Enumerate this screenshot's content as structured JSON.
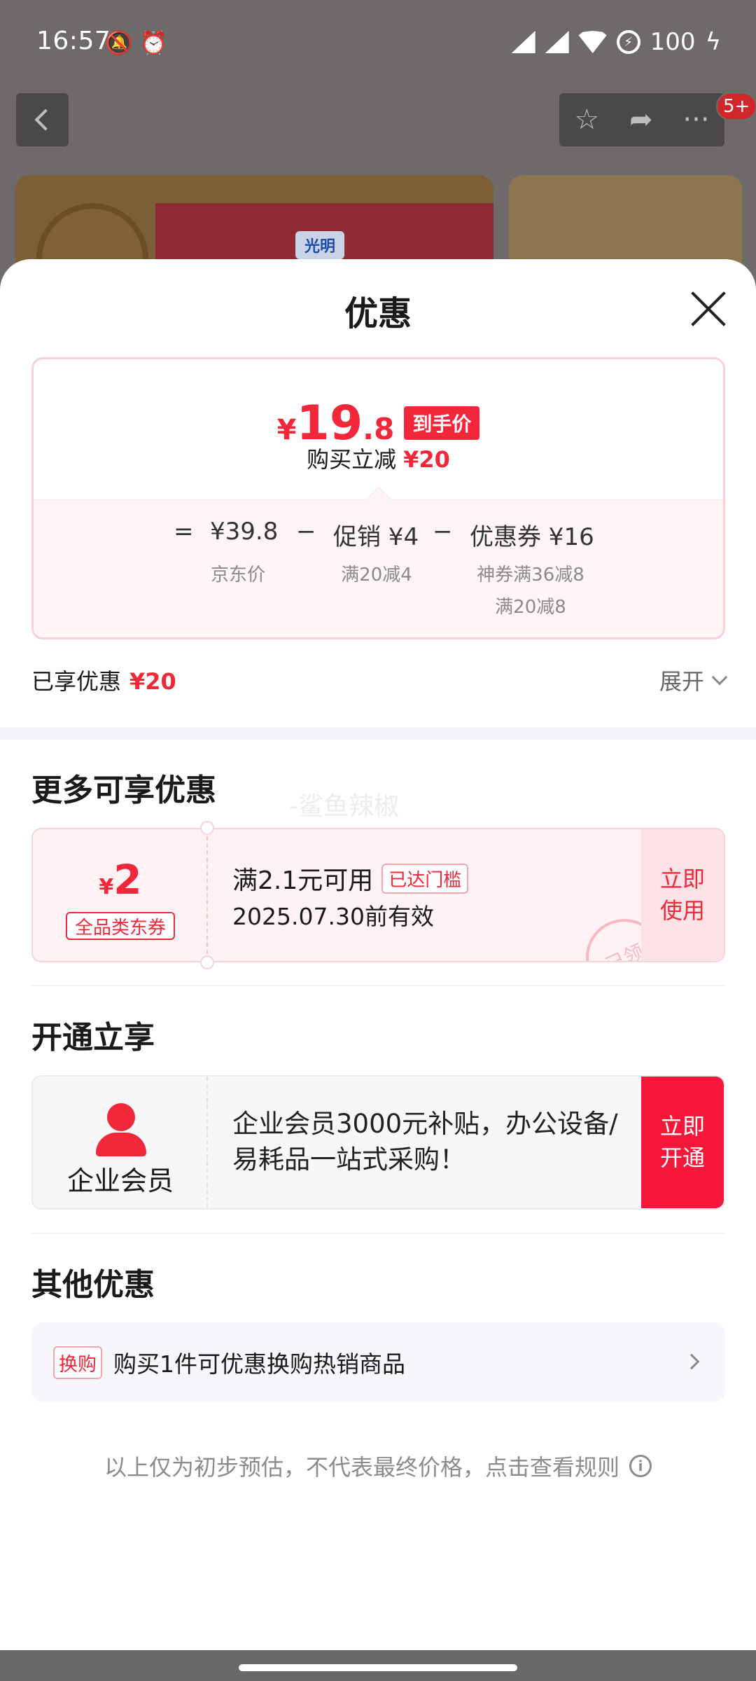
{
  "status_bar": {
    "time": "16:57",
    "battery": "100",
    "left_icons": [
      "mute-icon",
      "alarm-icon"
    ],
    "right_icons": [
      "signal-icon",
      "signal-icon",
      "wifi-icon",
      "battery-saver-icon",
      "charging-icon"
    ]
  },
  "background_page": {
    "badge": "5+",
    "product_logo_text": "光明"
  },
  "sheet": {
    "title": "优惠",
    "price_card": {
      "currency": "¥",
      "price_int": "19",
      "price_dec": ".8",
      "hand_price_tag": "到手价",
      "buy_reduce_label": "购买立减",
      "buy_reduce_value": "¥20",
      "formula": {
        "equals": "=",
        "jd_price": "¥39.8",
        "jd_price_label": "京东价",
        "minus1": "−",
        "promo": "促销 ¥4",
        "promo_label": "满20减4",
        "minus2": "−",
        "coupon": "优惠券 ¥16",
        "coupon_label1": "神券满36减8",
        "coupon_label2": "满20减8"
      }
    },
    "enjoyed_label": "已享优惠",
    "enjoyed_value": "¥20",
    "expand_label": "展开",
    "more_section_title": "更多可享优惠",
    "watermark": "-鲨鱼辣椒",
    "coupon": {
      "currency": "¥",
      "amount": "2",
      "tag": "全品类东券",
      "condition": "满2.1元可用",
      "reached_tag": "已达门槛",
      "expiry": "2025.07.30前有效",
      "use_label": "立即使用",
      "stamp": "已领"
    },
    "open_section_title": "开通立享",
    "member": {
      "name": "企业会员",
      "desc": "企业会员3000元补贴，办公设备/易耗品一站式采购！",
      "open_label": "立即开通"
    },
    "other_section_title": "其他优惠",
    "other": {
      "tag": "换购",
      "text": "购买1件可优惠换购热销商品"
    },
    "disclaimer": "以上仅为初步预估，不代表最终价格，点击查看规则",
    "info_icon": "i"
  },
  "colors": {
    "accent_red": "#f2273a",
    "overlay": "#6e6a6a"
  }
}
